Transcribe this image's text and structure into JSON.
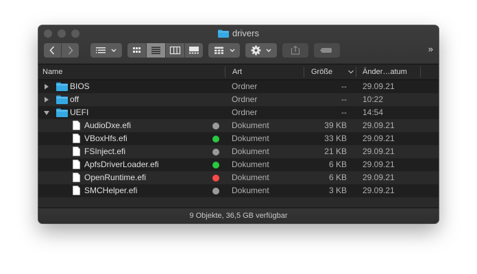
{
  "window": {
    "title": "drivers"
  },
  "toolbar": {
    "back_icon": "chevron-left-icon",
    "forward_icon": "chevron-right-icon",
    "view_modes": [
      "icon-view-icon",
      "list-view-icon",
      "column-view-icon",
      "gallery-view-icon"
    ],
    "active_view": "list",
    "more": "»"
  },
  "columns": {
    "name": "Name",
    "kind": "Art",
    "size": "Größe",
    "date": "Änder…atum"
  },
  "rows": [
    {
      "name": "BIOS",
      "kind": "Ordner",
      "size": "--",
      "date": "29.09.21",
      "type": "folder",
      "expanded": false,
      "indent": 0
    },
    {
      "name": "off",
      "kind": "Ordner",
      "size": "--",
      "date": "10:22",
      "type": "folder",
      "expanded": false,
      "indent": 0
    },
    {
      "name": "UEFI",
      "kind": "Ordner",
      "size": "--",
      "date": "14:54",
      "type": "folder",
      "expanded": true,
      "indent": 0
    },
    {
      "name": "AudioDxe.efi",
      "kind": "Dokument",
      "size": "39 KB",
      "date": "29.09.21",
      "type": "file",
      "tag": "#9a9a9a",
      "indent": 1
    },
    {
      "name": "VBoxHfs.efi",
      "kind": "Dokument",
      "size": "33 KB",
      "date": "29.09.21",
      "type": "file",
      "tag": "#2bc840",
      "indent": 1
    },
    {
      "name": "FSInject.efi",
      "kind": "Dokument",
      "size": "21 KB",
      "date": "29.09.21",
      "type": "file",
      "tag": "#9a9a9a",
      "indent": 1
    },
    {
      "name": "ApfsDriverLoader.efi",
      "kind": "Dokument",
      "size": "6 KB",
      "date": "29.09.21",
      "type": "file",
      "tag": "#2bc840",
      "indent": 1
    },
    {
      "name": "OpenRuntime.efi",
      "kind": "Dokument",
      "size": "6 KB",
      "date": "29.09.21",
      "type": "file",
      "tag": "#fc4a4a",
      "indent": 1
    },
    {
      "name": "SMCHelper.efi",
      "kind": "Dokument",
      "size": "3 KB",
      "date": "29.09.21",
      "type": "file",
      "tag": "#9a9a9a",
      "indent": 1
    }
  ],
  "status": {
    "text": "9 Objekte, 36,5 GB verfügbar"
  },
  "colors": {
    "folder": "#35a9e2",
    "accent_active_view": "#8a8a8a"
  }
}
